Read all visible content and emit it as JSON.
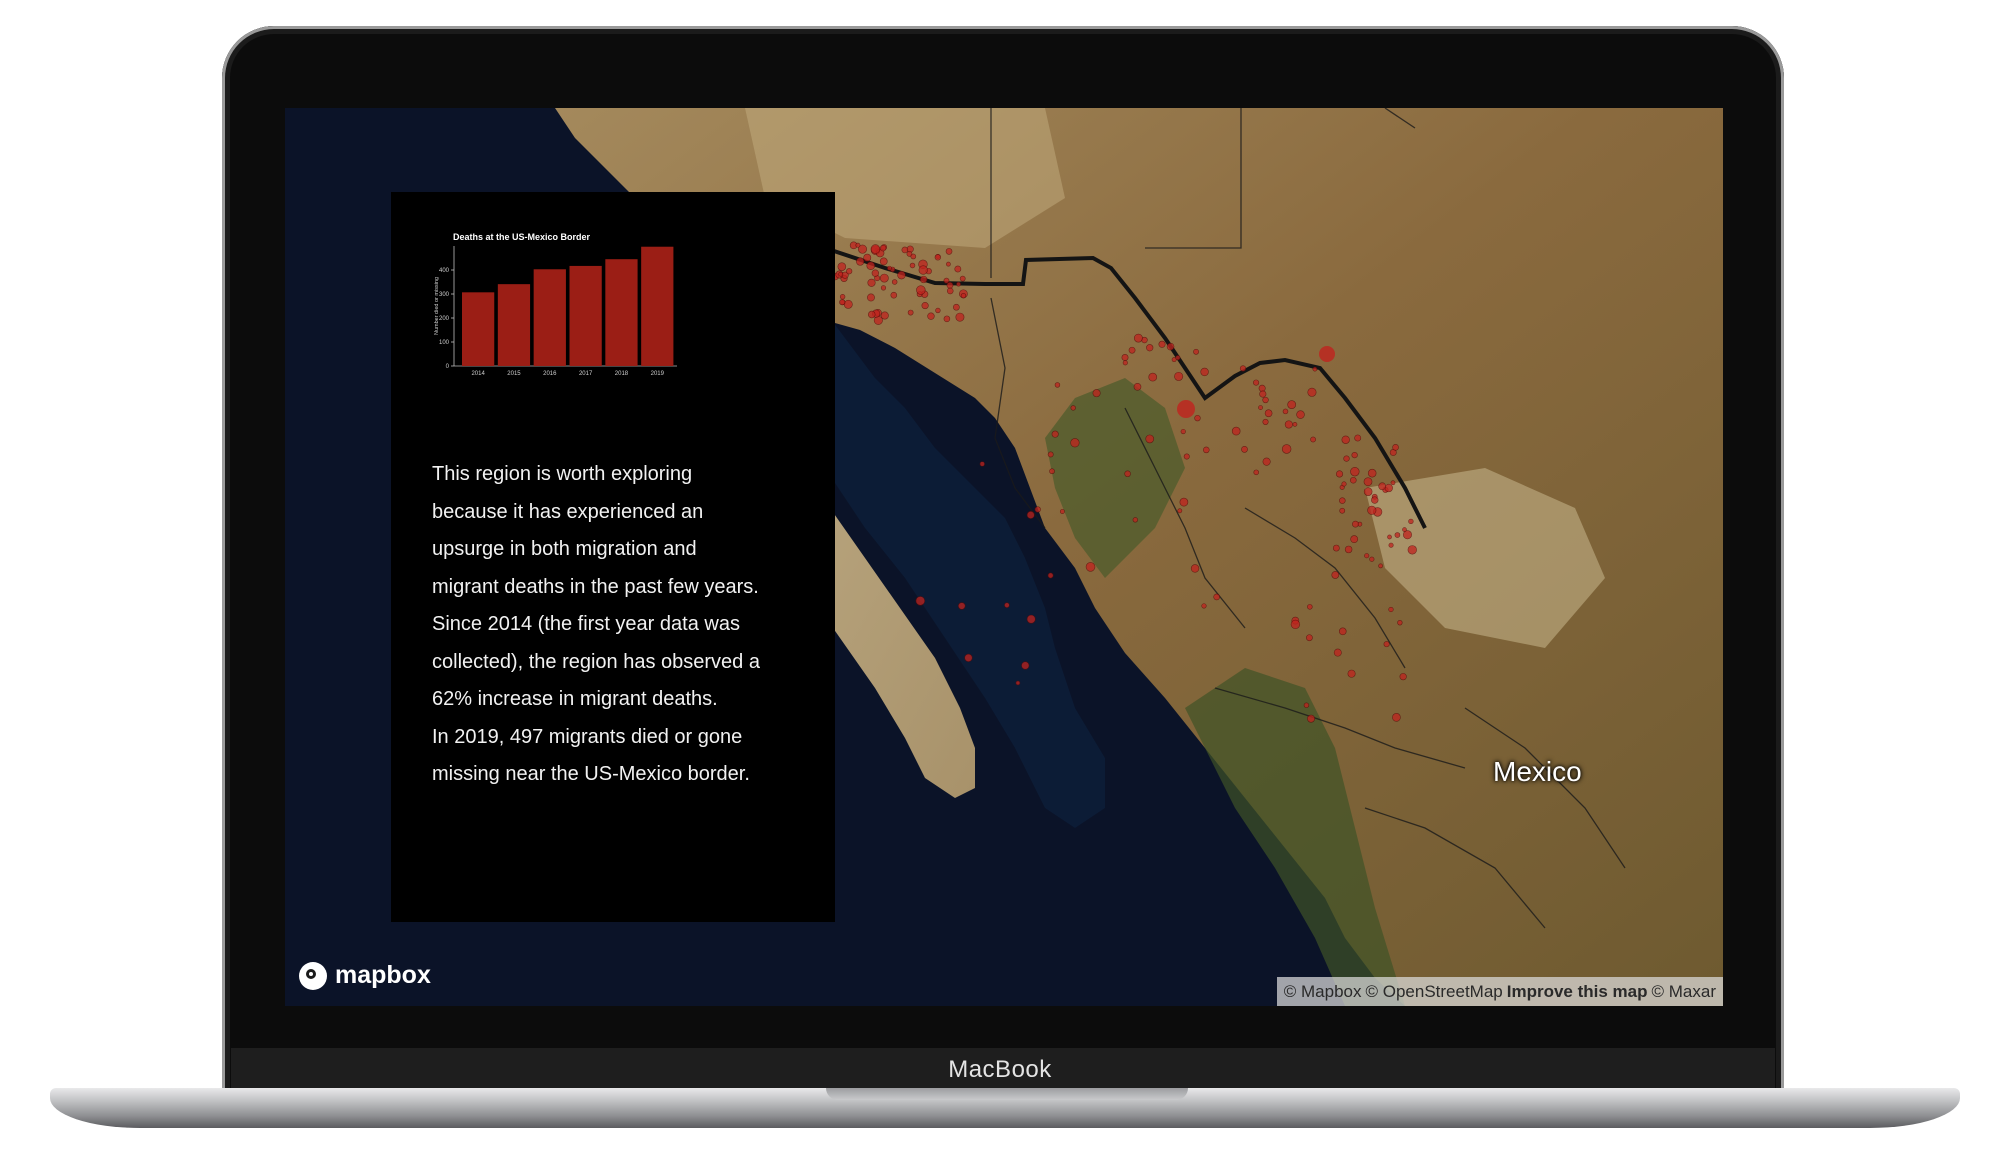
{
  "device": {
    "brand_label": "MacBook"
  },
  "map": {
    "place_label": "Mexico",
    "logo_text": "mapbox",
    "attribution": {
      "mapbox": "© Mapbox",
      "osm": "© OpenStreetMap",
      "improve": "Improve this map",
      "maxar": "© Maxar"
    },
    "colors": {
      "ocean": "#0b1328",
      "land": "#8a6e43",
      "vegetation": "#4a5a2e",
      "incident": "#c0231e",
      "border": "#1a1a1a"
    }
  },
  "panel": {
    "paragraphs": [
      "This region is worth exploring because it has experienced an upsurge in both migration and migrant deaths in the past few years. Since 2014 (the first year data was collected), the region has observed a 62% increase in migrant deaths.",
      "In 2019, 497 migrants died or gone missing near the US-Mexico border."
    ]
  },
  "chart_data": {
    "type": "bar",
    "title": "Deaths at the US-Mexico Border",
    "ylabel": "Number died or missing",
    "xlabel": "",
    "categories": [
      "2014",
      "2015",
      "2016",
      "2017",
      "2018",
      "2019"
    ],
    "values": [
      307,
      341,
      403,
      417,
      445,
      497
    ],
    "ylim": [
      0,
      500
    ],
    "yticks": [
      0,
      100,
      200,
      300,
      400
    ],
    "bar_color": "#9b1e15",
    "grid": false
  }
}
